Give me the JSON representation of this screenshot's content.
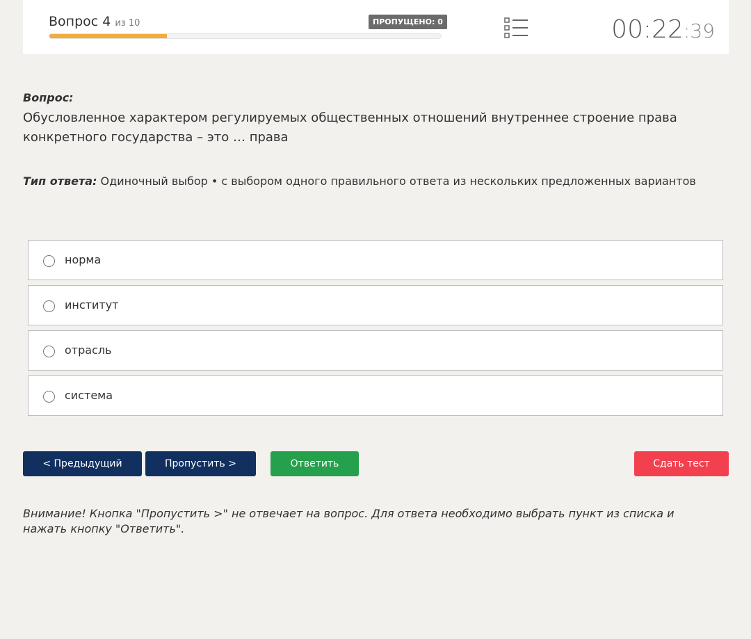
{
  "header": {
    "question_word": "Вопрос 4",
    "of_total": "из 10",
    "skipped_badge": "ПРОПУЩЕНО: 0",
    "progress": 0.3,
    "timer_main": "00:22",
    "timer_sep": ":",
    "timer_seconds": "39"
  },
  "question": {
    "label": "Вопрос:",
    "text": "Обусловленное характером регулируемых общественных отношений внутреннее строение права конкретного государства – это … права"
  },
  "answer_type": {
    "label": "Тип ответа:",
    "value": " Одиночный выбор • с выбором одного правильного ответа из нескольких предложенных вариантов"
  },
  "options": [
    {
      "label": "норма"
    },
    {
      "label": "институт"
    },
    {
      "label": "отрасль"
    },
    {
      "label": "система"
    }
  ],
  "buttons": {
    "prev": "< Предыдущий",
    "skip": "Пропустить >",
    "answer": "Ответить",
    "submit": "Сдать тест"
  },
  "notice": "Внимание! Кнопка \"Пропустить >\" не отвечает на вопрос. Для ответа необходимо выбрать пункт из списка и нажать кнопку \"Ответить\".",
  "colors": {
    "progress_fill": "#f0ad3e",
    "nav_button": "#12305f",
    "answer_button": "#25a04c",
    "submit_button": "#f2404f"
  },
  "icons": {
    "question_list": "list-icon"
  }
}
